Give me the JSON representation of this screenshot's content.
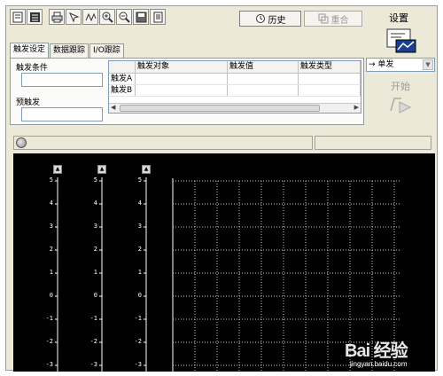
{
  "toolbar": {
    "history_label": "历史",
    "reset_label": "重合",
    "settings_label": "设置"
  },
  "tabs": [
    {
      "label": "触发设定",
      "active": true
    },
    {
      "label": "数据跟踪",
      "active": false
    },
    {
      "label": "I/O跟踪",
      "active": false
    }
  ],
  "trigger": {
    "condition_label": "触发条件",
    "pretrigger_label": "预触发",
    "table": {
      "headers": [
        "",
        "触发对象",
        "触发值",
        "触发类型"
      ],
      "rows": [
        [
          "触发A",
          "",
          "",
          ""
        ],
        [
          "触发B",
          "",
          "",
          ""
        ]
      ]
    },
    "direction_value": "单发",
    "direction_arrow": "→",
    "start_label": "开始"
  },
  "scope": {
    "y_ticks": [
      "5",
      "4",
      "3",
      "2",
      "1",
      "0",
      "-1",
      "-2",
      "-3"
    ],
    "axis_button_glyph": "▲"
  },
  "watermark": {
    "logo": "Bai 经验",
    "url": "jingyan.baidu.com"
  },
  "colors": {
    "window_bg": "#ece9d8",
    "scope_bg": "#000000",
    "grid": "#d0d0d0"
  }
}
